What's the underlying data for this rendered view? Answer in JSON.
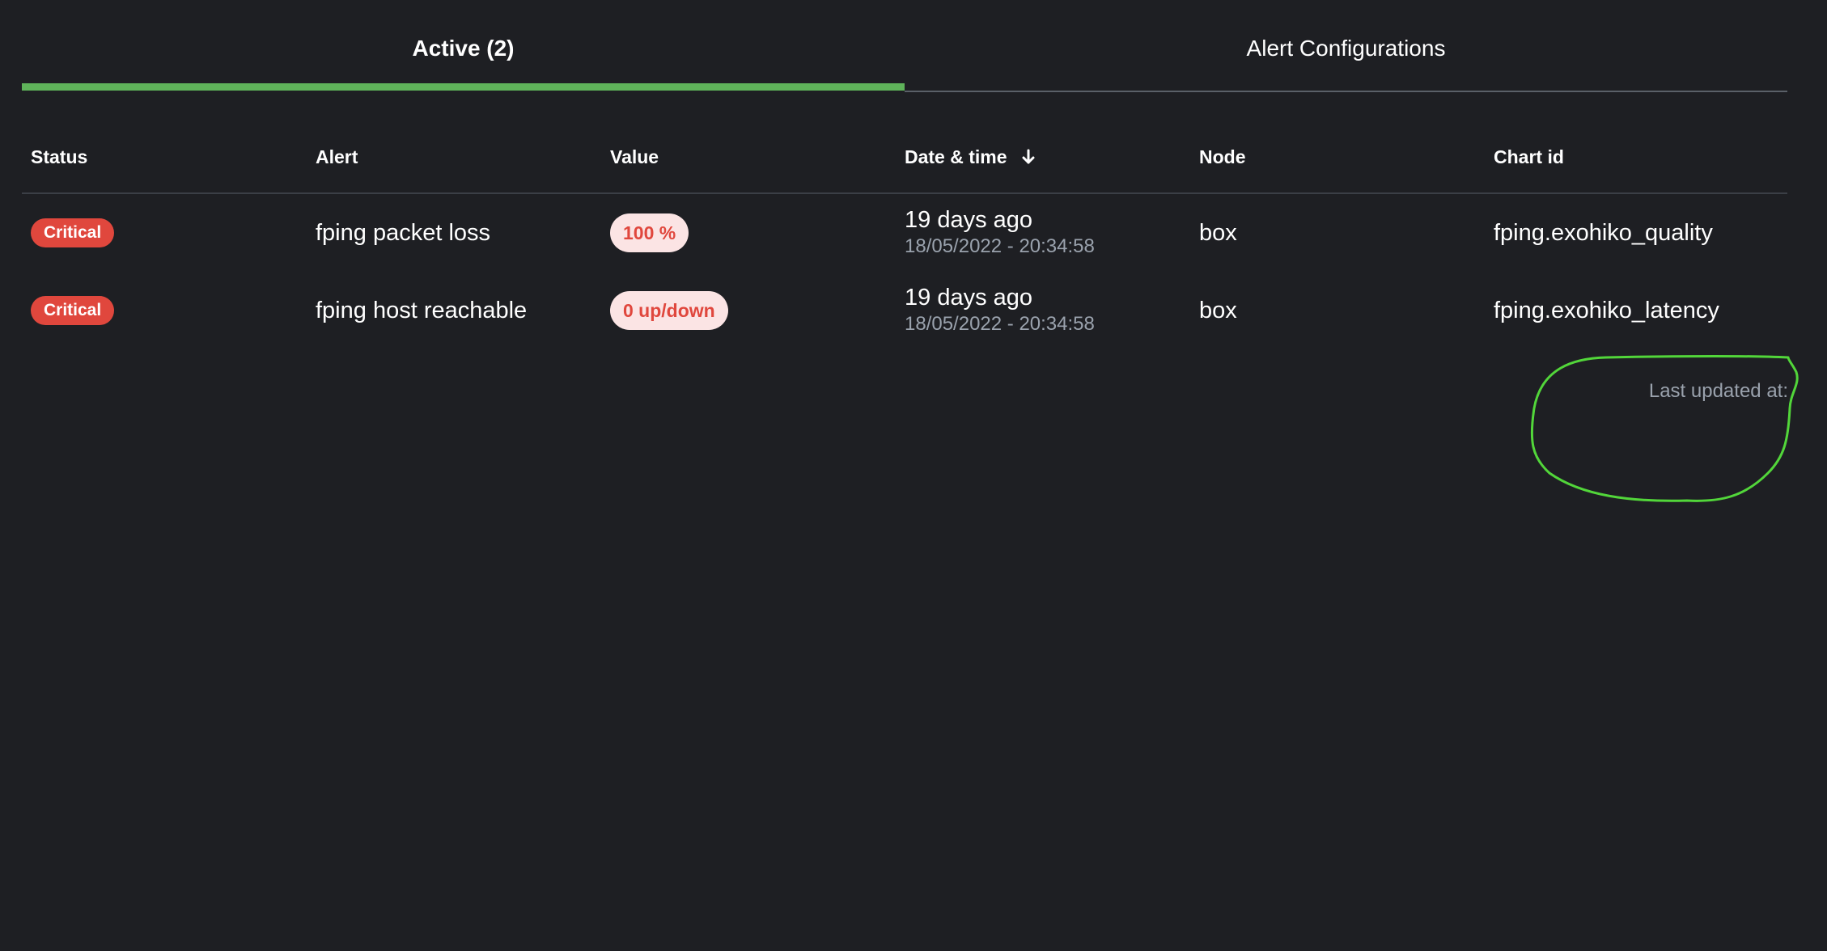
{
  "tabs": [
    {
      "label": "Active (2)",
      "active": true
    },
    {
      "label": "Alert Configurations",
      "active": false
    }
  ],
  "table": {
    "headers": {
      "status": "Status",
      "alert": "Alert",
      "value": "Value",
      "date": "Date & time",
      "node": "Node",
      "chart": "Chart id"
    },
    "sort_icon": "arrow-down-icon",
    "rows": [
      {
        "status": "Critical",
        "alert": "fping packet loss",
        "value": "100 %",
        "date_relative": "19 days ago",
        "date_abs": "18/05/2022 - 20:34:58",
        "node": "box",
        "chart": "fping.exohiko_quality"
      },
      {
        "status": "Critical",
        "alert": "fping host reachable",
        "value": "0 up/down",
        "date_relative": "19 days ago",
        "date_abs": "18/05/2022 - 20:34:58",
        "node": "box",
        "chart": "fping.exohiko_latency"
      }
    ]
  },
  "footer": {
    "last_updated": "Last updated at:"
  },
  "colors": {
    "background": "#1e1f23",
    "accent_green": "#5fb35a",
    "critical_red": "#e0473d",
    "value_pill_bg": "#fbe4e4",
    "muted_text": "#9aa2ad",
    "annotation_green": "#52d63a"
  }
}
